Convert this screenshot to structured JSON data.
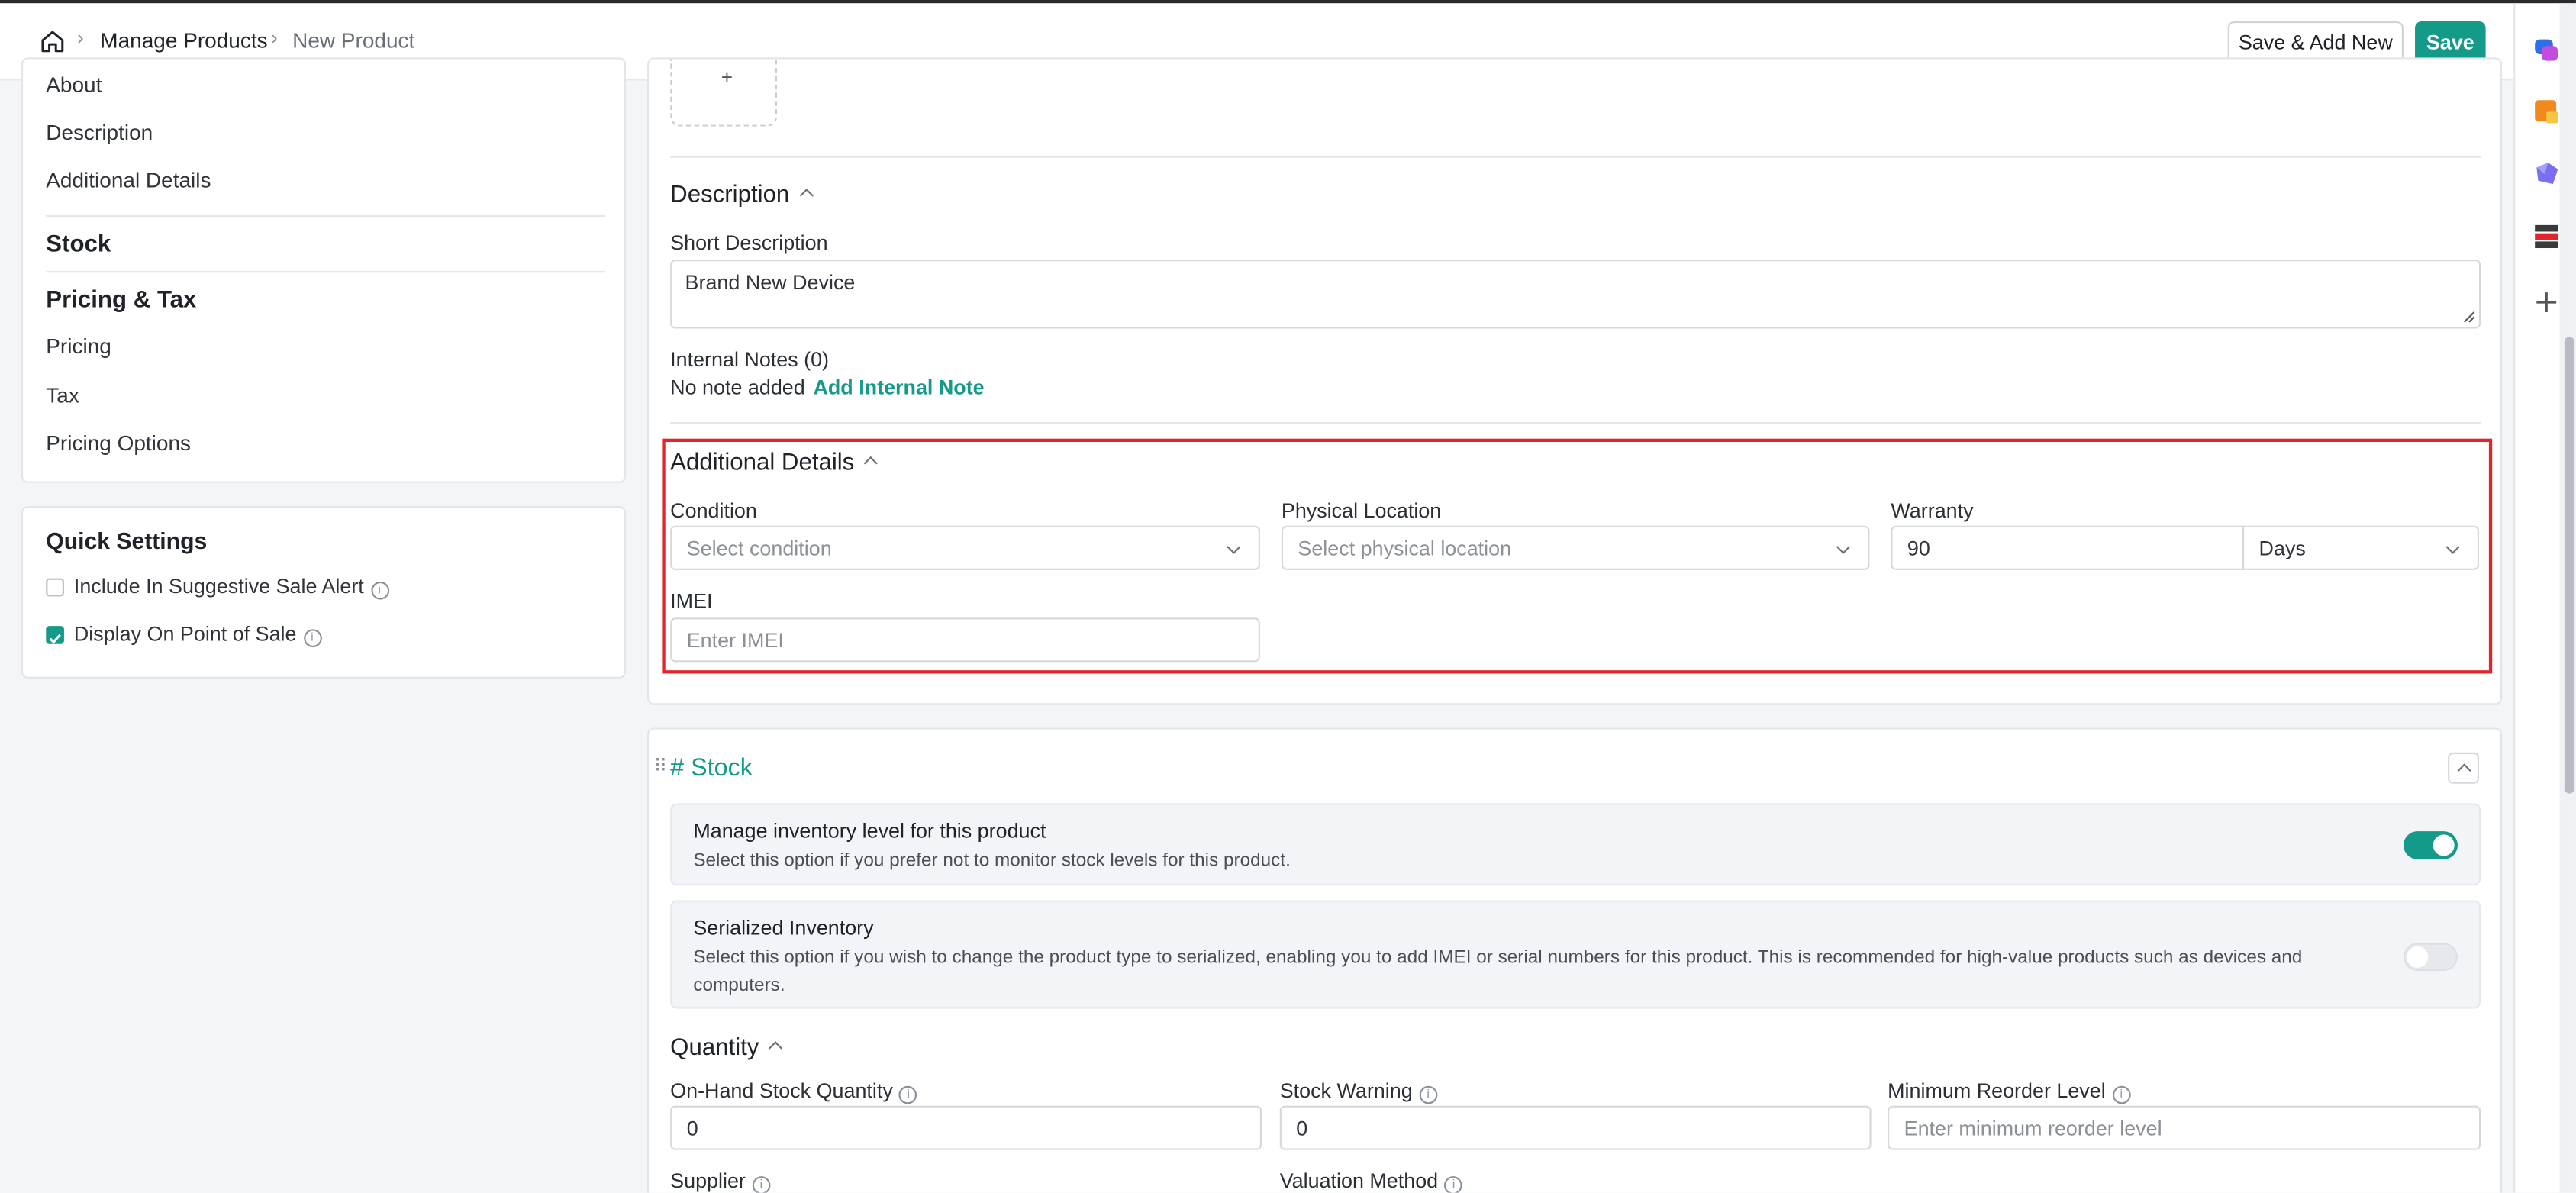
{
  "header": {
    "breadcrumb": [
      "Manage Products",
      "New Product"
    ],
    "save_add_new_label": "Save & Add New",
    "save_label": "Save"
  },
  "sidebar": {
    "general_items": [
      "About",
      "Description",
      "Additional Details"
    ],
    "stock_group": "Stock",
    "pricing_group": "Pricing & Tax",
    "pricing_items": [
      "Pricing",
      "Tax",
      "Pricing Options"
    ]
  },
  "quick_settings": {
    "title": "Quick Settings",
    "options": [
      {
        "label": "Include In Suggestive Sale Alert",
        "checked": false
      },
      {
        "label": "Display On Point of Sale",
        "checked": true
      }
    ]
  },
  "description": {
    "title": "Description",
    "short_label": "Short Description",
    "short_value": "Brand New Device",
    "notes_label": "Internal Notes (0)",
    "notes_empty": "No note added",
    "add_note": "Add Internal Note"
  },
  "additional": {
    "title": "Additional Details",
    "condition_label": "Condition",
    "condition_placeholder": "Select condition",
    "location_label": "Physical Location",
    "location_placeholder": "Select physical location",
    "warranty_label": "Warranty",
    "warranty_value": "90",
    "warranty_unit": "Days",
    "imei_label": "IMEI",
    "imei_placeholder": "Enter IMEI"
  },
  "stock": {
    "title": "# Stock",
    "manage_title": "Manage inventory level for this product",
    "manage_desc": "Select this option if you prefer not to monitor stock levels for this product.",
    "manage_on": true,
    "serialized_title": "Serialized Inventory",
    "serialized_desc": "Select this option if you wish to change the product type to serialized, enabling you to add IMEI or serial numbers for this product. This is recommended for high-value products such as devices and computers.",
    "serialized_on": false
  },
  "quantity": {
    "title": "Quantity",
    "onhand_label": "On-Hand Stock Quantity",
    "onhand_value": "0",
    "warning_label": "Stock Warning",
    "warning_value": "0",
    "reorder_label": "Minimum Reorder Level",
    "reorder_placeholder": "Enter minimum reorder level",
    "supplier_label": "Supplier",
    "valuation_label": "Valuation Method"
  },
  "colors": {
    "accent": "#149a88",
    "highlight": "#e5232a"
  }
}
